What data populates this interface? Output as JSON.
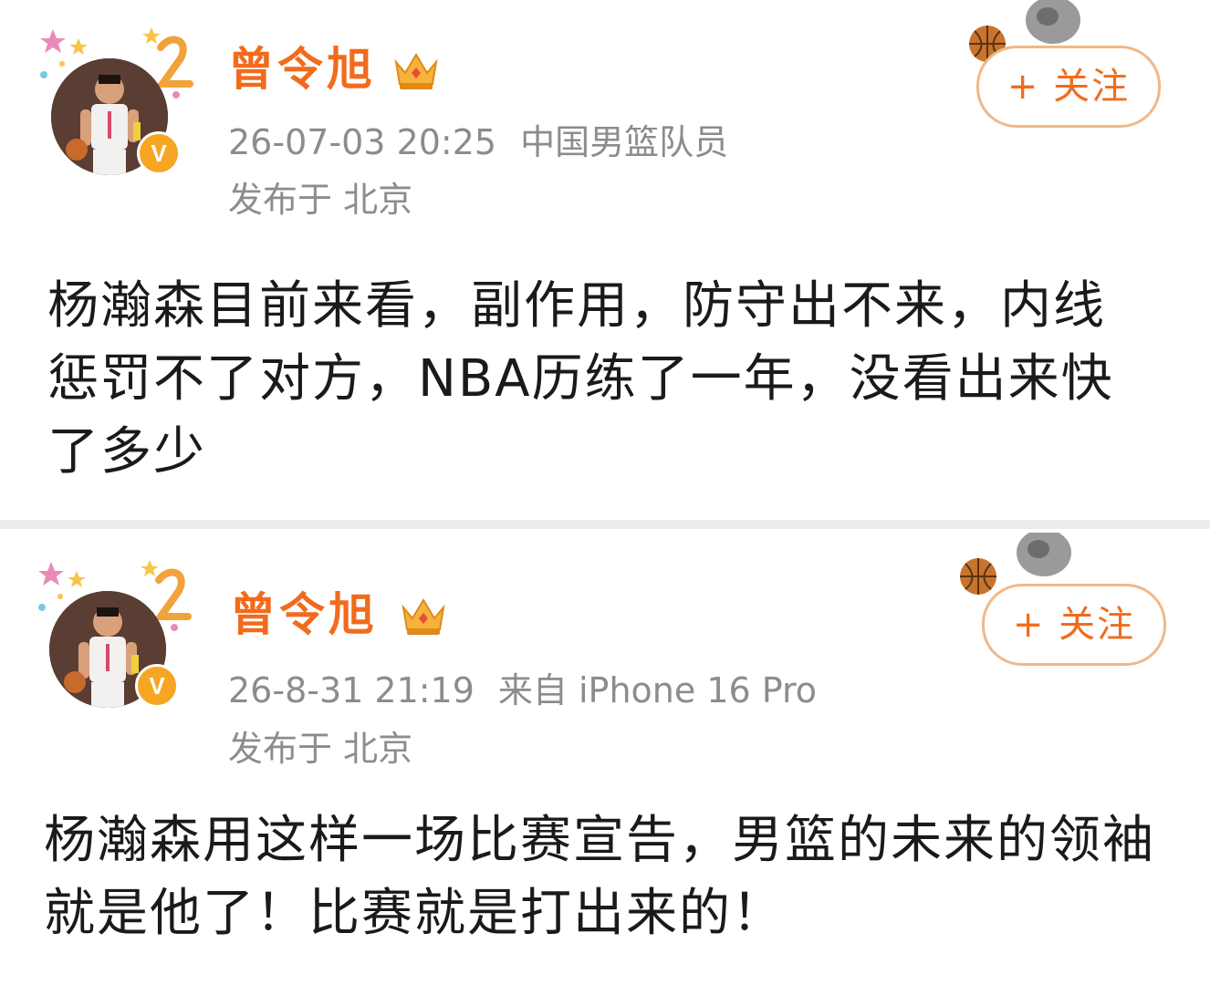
{
  "posts": [
    {
      "username": "曾令旭",
      "timestamp": "26-07-03 20:25",
      "source": "中国男篮队员",
      "location": "发布于 北京",
      "follow_label": "+ 关注",
      "verified_badge": "V",
      "content_lines": [
        "杨瀚森目前来看，副作用，防守出不来，内线",
        "惩罚不了对方，NBA历练了一年，没看出来快",
        "了多少"
      ]
    },
    {
      "username": "曾令旭",
      "timestamp": "26-8-31 21:19",
      "source": "来自 iPhone 16 Pro",
      "location": "发布于 北京",
      "follow_label": "+ 关注",
      "verified_badge": "V",
      "content_lines": [
        "杨瀚森用这样一场比赛宣告，男篮的未来的领袖",
        "就是他了！比赛就是打出来的！"
      ]
    }
  ],
  "colors": {
    "username": "#f26b1d",
    "meta": "#8c8c8c",
    "follow_border": "#f0b889",
    "badge": "#f6a623",
    "divider": "#ececec"
  },
  "icons": {
    "crown": "crown-icon",
    "verified": "verified-v-icon",
    "basketball": "basketball-icon"
  }
}
